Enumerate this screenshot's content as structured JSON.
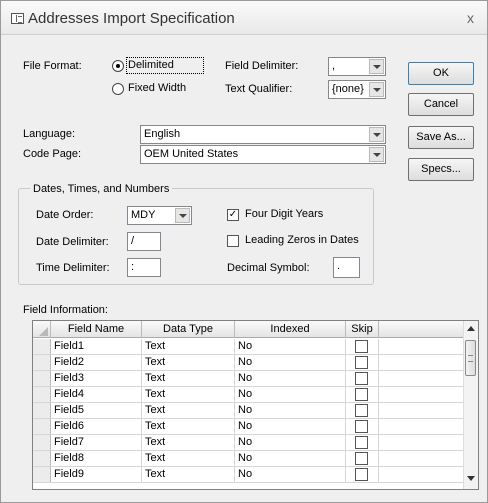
{
  "window": {
    "title": "Addresses Import Specification",
    "close_symbol": "x"
  },
  "format": {
    "file_format_label": "File Format:",
    "delimited_label": "Delimited",
    "fixed_width_label": "Fixed Width",
    "selected": "Delimited",
    "field_delimiter_label": "Field Delimiter:",
    "field_delimiter_value": ",",
    "text_qualifier_label": "Text Qualifier:",
    "text_qualifier_value": "{none}"
  },
  "buttons": {
    "ok": "OK",
    "cancel": "Cancel",
    "save_as": "Save As...",
    "specs": "Specs..."
  },
  "locale": {
    "language_label": "Language:",
    "language_value": "English",
    "code_page_label": "Code Page:",
    "code_page_value": "OEM United States"
  },
  "dtn": {
    "group_label": "Dates, Times, and Numbers",
    "date_order_label": "Date Order:",
    "date_order_value": "MDY",
    "date_delimiter_label": "Date Delimiter:",
    "date_delimiter_value": "/",
    "time_delimiter_label": "Time Delimiter:",
    "time_delimiter_value": ":",
    "four_digit_years_label": "Four Digit Years",
    "four_digit_years_checked": true,
    "leading_zeros_label": "Leading Zeros in Dates",
    "leading_zeros_checked": false,
    "decimal_symbol_label": "Decimal Symbol:",
    "decimal_symbol_value": "."
  },
  "fields": {
    "section_label": "Field Information:",
    "columns": [
      "Field Name",
      "Data Type",
      "Indexed",
      "Skip"
    ],
    "rows": [
      {
        "name": "Field1",
        "type": "Text",
        "indexed": "No",
        "skip": false
      },
      {
        "name": "Field2",
        "type": "Text",
        "indexed": "No",
        "skip": false
      },
      {
        "name": "Field3",
        "type": "Text",
        "indexed": "No",
        "skip": false
      },
      {
        "name": "Field4",
        "type": "Text",
        "indexed": "No",
        "skip": false
      },
      {
        "name": "Field5",
        "type": "Text",
        "indexed": "No",
        "skip": false
      },
      {
        "name": "Field6",
        "type": "Text",
        "indexed": "No",
        "skip": false
      },
      {
        "name": "Field7",
        "type": "Text",
        "indexed": "No",
        "skip": false
      },
      {
        "name": "Field8",
        "type": "Text",
        "indexed": "No",
        "skip": false
      },
      {
        "name": "Field9",
        "type": "Text",
        "indexed": "No",
        "skip": false
      }
    ]
  }
}
